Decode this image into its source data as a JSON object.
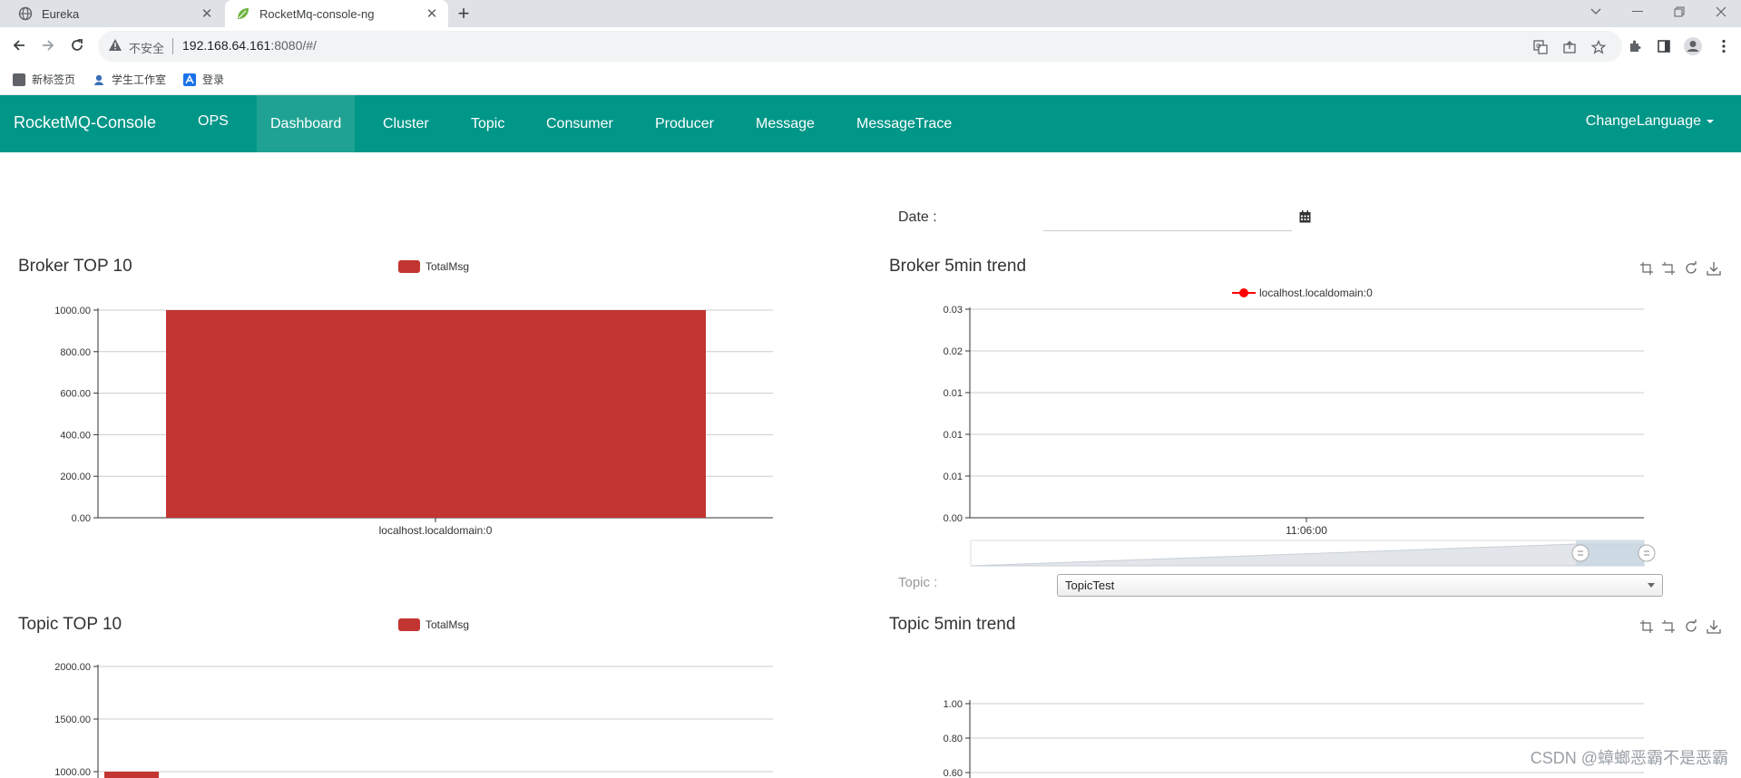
{
  "browser": {
    "tabs": [
      {
        "title": "Eureka",
        "active": false
      },
      {
        "title": "RocketMq-console-ng",
        "active": true
      }
    ],
    "address": {
      "security_text": "不安全",
      "host": "192.168.64.161",
      "rest": ":8080/#/"
    },
    "bookmarks": [
      {
        "label": "新标签页",
        "icon": "grey-square-icon"
      },
      {
        "label": "学生工作室",
        "icon": "student-studio-icon"
      },
      {
        "label": "登录",
        "icon": "login-icon"
      }
    ]
  },
  "navbar": {
    "brand": "RocketMQ-Console",
    "links": [
      "OPS",
      "Dashboard",
      "Cluster",
      "Topic",
      "Consumer",
      "Producer",
      "Message",
      "MessageTrace"
    ],
    "active": "Dashboard",
    "language": "ChangeLanguage",
    "color": "#009688"
  },
  "dashboard": {
    "date_label": "Date :",
    "date_value": "",
    "topic_label": "Topic :",
    "topic_selected": "TopicTest",
    "broker_top10_title": "Broker TOP 10",
    "broker_trend_title": "Broker 5min trend",
    "topic_top10_title": "Topic TOP 10",
    "topic_trend_title": "Topic 5min trend"
  },
  "chart_data": [
    {
      "type": "bar",
      "title": "Broker TOP 10",
      "legend": [
        "TotalMsg"
      ],
      "categories": [
        "localhost.localdomain:0"
      ],
      "series": [
        {
          "name": "TotalMsg",
          "values": [
            1000
          ]
        }
      ],
      "ylim": [
        0,
        1000
      ],
      "yticks": [
        "0.00",
        "200.00",
        "400.00",
        "600.00",
        "800.00",
        "1000.00"
      ],
      "color": "#c23531",
      "grid": true,
      "legend_position": "top-center"
    },
    {
      "type": "line",
      "title": "Broker 5min trend",
      "legend": [
        "localhost.localdomain:0"
      ],
      "x": [
        "11:06:00"
      ],
      "series": [
        {
          "name": "localhost.localdomain:0",
          "values": []
        }
      ],
      "yticks": [
        "0.00",
        "0.01",
        "0.01",
        "0.01",
        "0.02",
        "0.03"
      ],
      "color": "#ff0000",
      "grid": true,
      "legend_position": "top-center",
      "toolbox": [
        "zoom",
        "zoom-reset",
        "restore",
        "save-image"
      ]
    },
    {
      "type": "bar",
      "title": "Topic TOP 10",
      "legend": [
        "TotalMsg"
      ],
      "categories": [
        ""
      ],
      "series": [
        {
          "name": "TotalMsg",
          "values": [
            1000
          ]
        }
      ],
      "ylim": [
        0,
        2000
      ],
      "yticks": [
        "1000.00",
        "1500.00",
        "2000.00"
      ],
      "color": "#c23531",
      "grid": true,
      "legend_position": "top-center"
    },
    {
      "type": "line",
      "title": "Topic 5min trend",
      "series": [],
      "yticks": [
        "0.60",
        "0.80",
        "1.00"
      ],
      "grid": true,
      "toolbox": [
        "zoom",
        "zoom-reset",
        "restore",
        "save-image"
      ]
    }
  ],
  "watermark": "CSDN @蟑螂恶霸不是恶霸"
}
